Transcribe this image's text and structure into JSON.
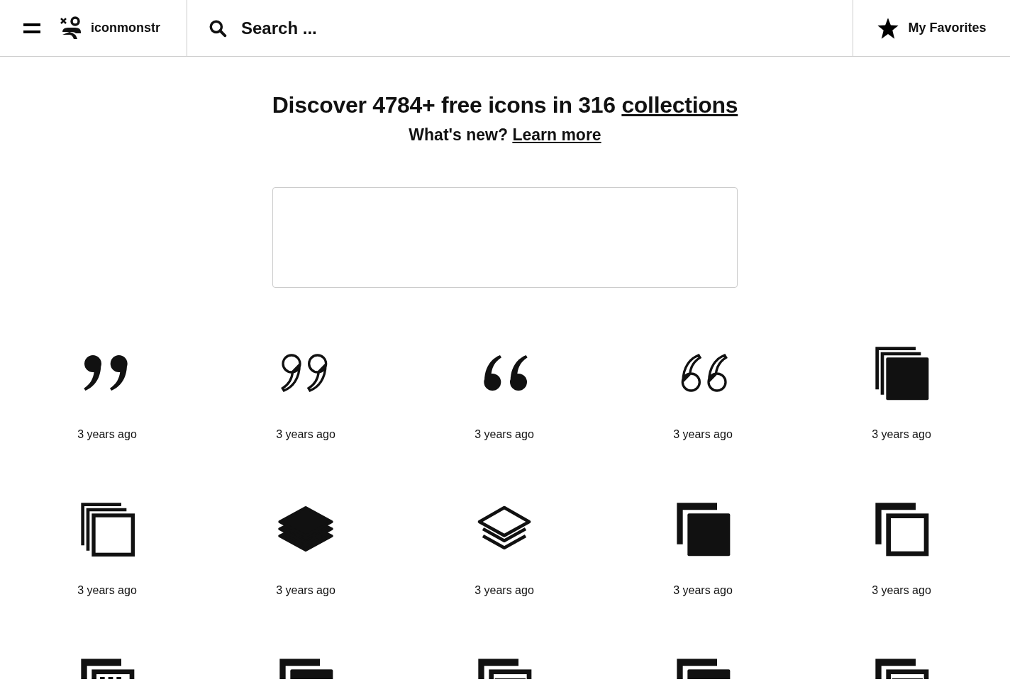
{
  "header": {
    "logo_text": "iconmonstr",
    "search": {
      "placeholder": "Search ..."
    },
    "favorites": "My Favorites"
  },
  "hero": {
    "headline": "Discover 4784+ free icons in 316 ",
    "headline_link": "collections",
    "subline": "What's new? ",
    "subline_link": "Learn more"
  },
  "icons": [
    {
      "kind": "quote-close-filled",
      "time": "3 years ago"
    },
    {
      "kind": "quote-close-outline",
      "time": "3 years ago"
    },
    {
      "kind": "quote-open-filled",
      "time": "3 years ago"
    },
    {
      "kind": "quote-open-outline",
      "time": "3 years ago"
    },
    {
      "kind": "squares-filled",
      "time": "3 years ago"
    },
    {
      "kind": "squares-outline",
      "time": "3 years ago"
    },
    {
      "kind": "layers-filled",
      "time": "3 years ago"
    },
    {
      "kind": "layers-outline",
      "time": "3 years ago"
    },
    {
      "kind": "copy-filled",
      "time": "3 years ago"
    },
    {
      "kind": "copy-outline",
      "time": "3 years ago"
    },
    {
      "kind": "window-dashed"
    },
    {
      "kind": "window-filled"
    },
    {
      "kind": "window-outline"
    },
    {
      "kind": "window-filled"
    },
    {
      "kind": "window-outline"
    }
  ]
}
